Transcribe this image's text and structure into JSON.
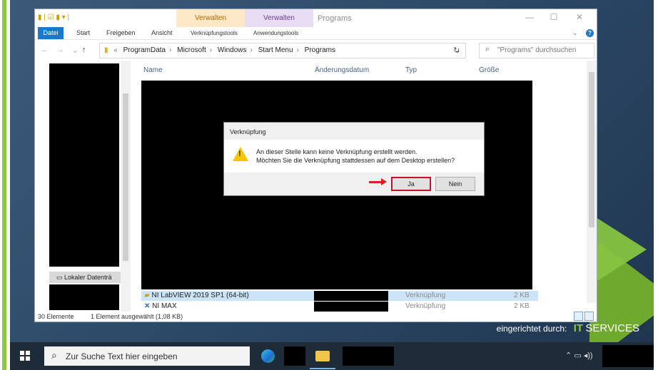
{
  "explorer": {
    "title": "Programs",
    "context_tabs": {
      "tab1_label": "Verwalten",
      "tab1_sub": "Verknüpfungstools",
      "tab2_label": "Verwalten",
      "tab2_sub": "Anwendungstools"
    },
    "ribbon_tabs": [
      "Datei",
      "Start",
      "Freigeben",
      "Ansicht"
    ],
    "breadcrumbs": [
      "ProgramData",
      "Microsoft",
      "Windows",
      "Start Menu",
      "Programs"
    ],
    "search_placeholder": "\"Programs\" durchsuchen",
    "columns": [
      "Name",
      "Änderungsdatum",
      "Typ",
      "Größe"
    ],
    "nav_item": "Lokaler Datenträ",
    "files": [
      {
        "name": "NI LabVIEW 2019 SP1 (64-bit)",
        "type": "Verknüpfung",
        "size": "2 KB"
      },
      {
        "name": "NI MAX",
        "type": "Verknüpfung",
        "size": "2 KB"
      }
    ],
    "status_count": "30 Elemente",
    "status_selected": "1 Element ausgewählt (1,08 KB)"
  },
  "dialog": {
    "title": "Verknüpfung",
    "line1": "An dieser Stelle kann keine Verknüpfung erstellt werden.",
    "line2": "Möchten Sie die Verknüpfung stattdessen auf dem Desktop erstellen?",
    "yes_label": "Ja",
    "no_label": "Nein"
  },
  "taskbar": {
    "search_placeholder": "Zur Suche Text hier eingeben"
  },
  "branding": {
    "label": "eingerichtet durch:",
    "it": "IT",
    "services": "SERVICES"
  },
  "colors": {
    "accent_green": "#8dc63f",
    "file_tab_blue": "#1979ca",
    "highlight_red": "#c2132a"
  }
}
